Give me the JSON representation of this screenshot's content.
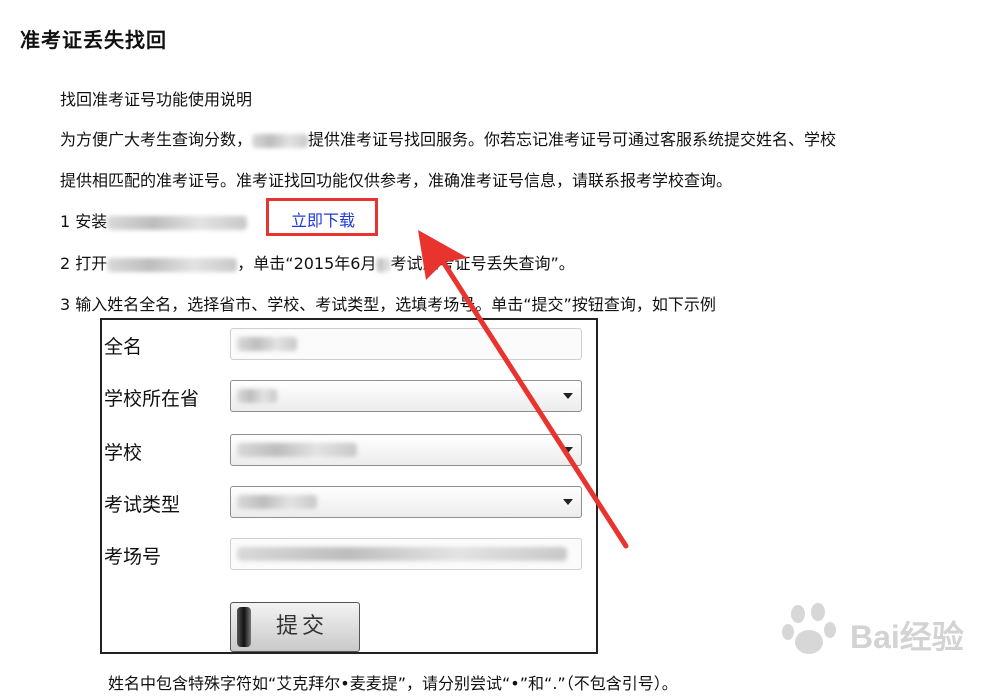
{
  "page": {
    "title": "准考证丢失找回"
  },
  "content": {
    "heading": "找回准考证号功能使用说明",
    "line1_a": "为方便广大考生查询分数，",
    "line1_b": "提供准考证号找回服务。你若忘记准考证号可通过客服系统提交姓名、学校",
    "line2": "提供相匹配的准考证号。准考证找回功能仅供参考，准确准考证号信息，请联系报考学校查询。",
    "step1_prefix": "1  安装",
    "step1_suffix": "",
    "download_label": "立即下载",
    "step2_prefix": "2  打开",
    "step2_suffix": "，单击“2015年6月",
    "step2_tail": "考试准考证号丢失查询”。",
    "step3": "3  输入姓名全名，选择省市、学校、考试类型，选填考场号。单击“提交”按钮查询，如下示例",
    "note": "姓名中包含特殊字符如“艾克拜尔•麦麦提”，请分别尝试“•”和“.”（不包含引号）。"
  },
  "form": {
    "name_label": "全名",
    "province_label": "学校所在省",
    "school_label": "学校",
    "exam_type_label": "考试类型",
    "room_label": "考场号",
    "submit_label": "提交"
  },
  "watermark": {
    "text": "Bai经验"
  },
  "colors": {
    "highlight_box": "#e8332f",
    "arrow": "#e8332f",
    "link": "#1f3ad6"
  }
}
